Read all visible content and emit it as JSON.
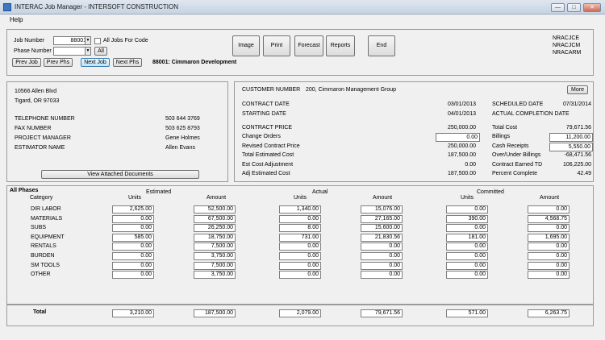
{
  "window": {
    "title": "INTERAC Job Manager - INTERSOFT CONSTRUCTION",
    "min_glyph": "—",
    "max_glyph": "□",
    "close_glyph": "✕"
  },
  "menu": {
    "help": "Help"
  },
  "job": {
    "job_number_label": "Job Number",
    "job_number_value": "88001",
    "all_jobs_label": "All Jobs For Code",
    "phase_number_label": "Phase Number",
    "phase_number_value": "",
    "all_button": "All",
    "prev_job": "Prev Job",
    "prev_phs": "Prev Phs",
    "next_job": "Next Job",
    "next_phs": "Next Phs",
    "job_title": "88001: Cimmaron Development"
  },
  "toolbar": {
    "image": "Image",
    "print": "Print",
    "forecast": "Forecast",
    "reports": "Reports",
    "end": "End"
  },
  "users": [
    "NRACJCE",
    "NRACJCM",
    "NRACARM"
  ],
  "address": {
    "line1": "10566 Allen Blvd",
    "line2": "Tigard, OR 97033",
    "telephone_label": "TELEPHONE NUMBER",
    "telephone": "503 644 3769",
    "fax_label": "FAX NUMBER",
    "fax": "503 625 8793",
    "pm_label": "PROJECT MANAGER",
    "pm": "Gene Holmes",
    "estimator_label": "ESTIMATOR NAME",
    "estimator": "Allen Evans",
    "view_docs": "View Attached Documents"
  },
  "contract": {
    "customer_label": "CUSTOMER NUMBER",
    "customer": "200, Cimmaron Management Group",
    "more": "More",
    "contract_date_label": "CONTRACT DATE",
    "contract_date": "03/01/2013",
    "starting_date_label": "STARTING DATE",
    "starting_date": "04/01/2013",
    "scheduled_date_label": "SCHEDULED DATE",
    "scheduled_date": "07/31/2014",
    "actual_completion_label": "ACTUAL COMPLETION DATE",
    "left": [
      {
        "label": "CONTRACT PRICE",
        "value": "250,000.00"
      },
      {
        "label": "Change Orders",
        "value": "0.00"
      },
      {
        "label": "Revised Contract Price",
        "value": "250,000.00"
      },
      {
        "label": "Total Estimated Cost",
        "value": "187,500.00"
      },
      {
        "label": "Est Cost Adjustment",
        "value": "0.00"
      },
      {
        "label": "Adj Estimated Cost",
        "value": "187,500.00"
      }
    ],
    "right": [
      {
        "label": "Total Cost",
        "value": "79,671.56"
      },
      {
        "label": "Billings",
        "value": "11,200.00"
      },
      {
        "label": "Cash Receipts",
        "value": "5,550.00"
      },
      {
        "label": "Over/Under Billings",
        "value": "-68,471.56"
      },
      {
        "label": "Contract Earned TD",
        "value": "106,225.00"
      },
      {
        "label": "Percent Complete",
        "value": "42.49"
      }
    ]
  },
  "phases": {
    "all_phases": "All Phases",
    "category_header": "Category",
    "estimated": "Estimated",
    "actual": "Actual",
    "committed": "Committed",
    "units": "Units",
    "amount": "Amount",
    "rows": [
      {
        "category": "DIR LABOR",
        "est_units": "2,625.00",
        "est_amount": "52,500.00",
        "act_units": "1,340.00",
        "act_amount": "15,076.00",
        "com_units": "0.00",
        "com_amount": "0.00"
      },
      {
        "category": "MATERIALS",
        "est_units": "0.00",
        "est_amount": "67,500.00",
        "act_units": "0.00",
        "act_amount": "27,165.00",
        "com_units": "390.00",
        "com_amount": "4,568.75"
      },
      {
        "category": "SUBS",
        "est_units": "0.00",
        "est_amount": "26,250.00",
        "act_units": "8.00",
        "act_amount": "15,600.00",
        "com_units": "0.00",
        "com_amount": "0.00"
      },
      {
        "category": "EQUIPMENT",
        "est_units": "585.00",
        "est_amount": "18,750.00",
        "act_units": "731.00",
        "act_amount": "21,830.56",
        "com_units": "181.00",
        "com_amount": "1,695.00"
      },
      {
        "category": "RENTALS",
        "est_units": "0.00",
        "est_amount": "7,500.00",
        "act_units": "0.00",
        "act_amount": "0.00",
        "com_units": "0.00",
        "com_amount": "0.00"
      },
      {
        "category": "BURDEN",
        "est_units": "0.00",
        "est_amount": "3,750.00",
        "act_units": "0.00",
        "act_amount": "0.00",
        "com_units": "0.00",
        "com_amount": "0.00"
      },
      {
        "category": "SM TOOLS",
        "est_units": "0.00",
        "est_amount": "7,500.00",
        "act_units": "0.00",
        "act_amount": "0.00",
        "com_units": "0.00",
        "com_amount": "0.00"
      },
      {
        "category": "OTHER",
        "est_units": "0.00",
        "est_amount": "3,750.00",
        "act_units": "0.00",
        "act_amount": "0.00",
        "com_units": "0.00",
        "com_amount": "0.00"
      }
    ],
    "total_label": "Total",
    "totals": {
      "est_units": "3,210.00",
      "est_amount": "187,500.00",
      "act_units": "2,079.00",
      "act_amount": "79,671.56",
      "com_units": "571.00",
      "com_amount": "6,263.75"
    }
  }
}
